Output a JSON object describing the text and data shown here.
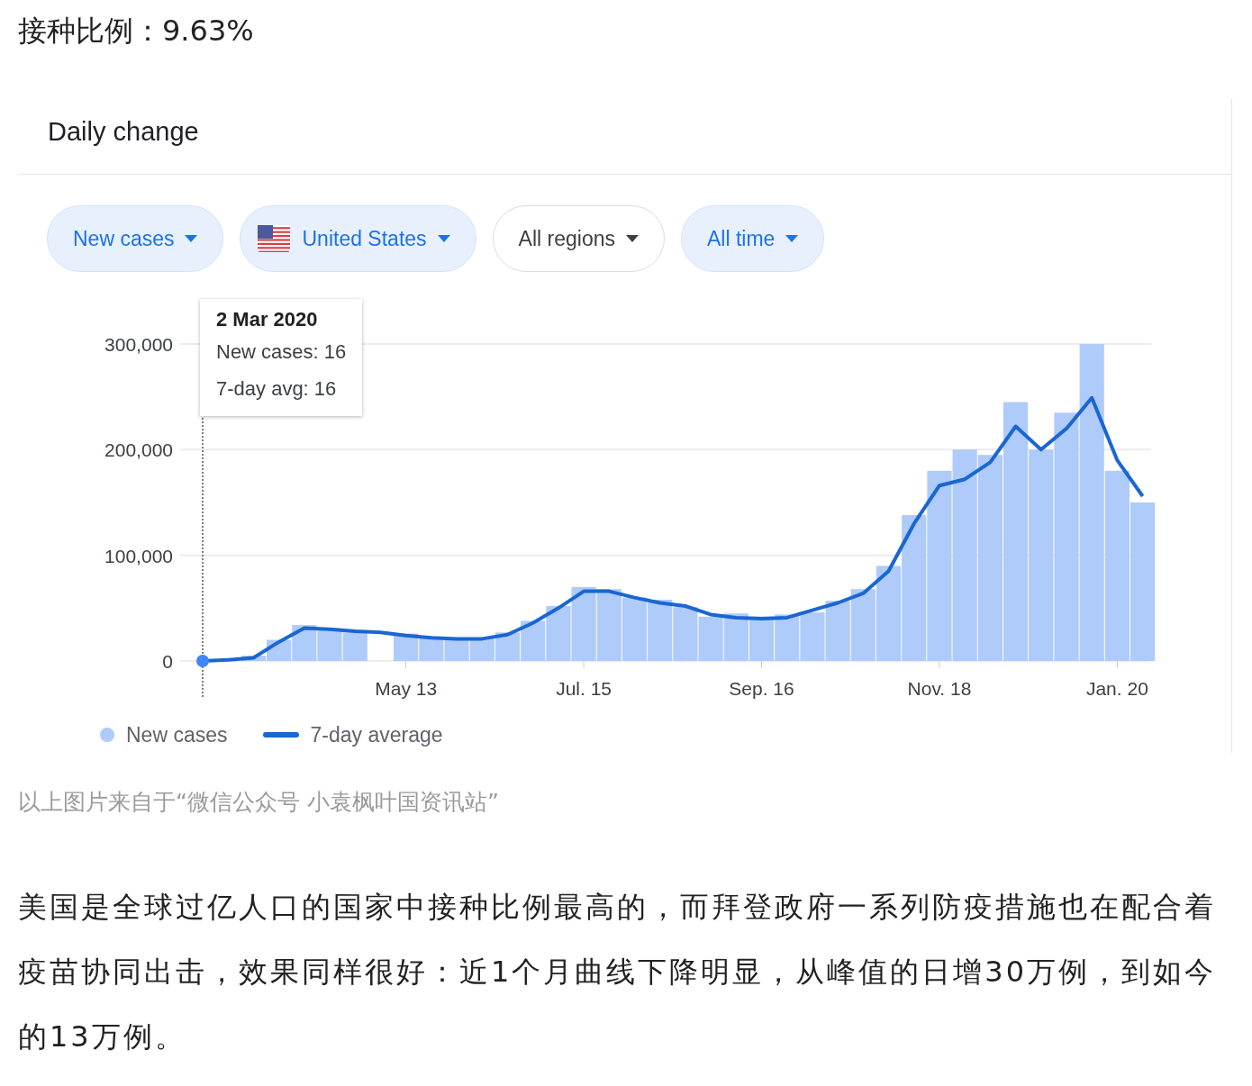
{
  "heading": "接种比例：9.63%",
  "card": {
    "title": "Daily change",
    "chips": [
      {
        "label": "New cases",
        "selected": true,
        "kind": "plain"
      },
      {
        "label": "United States",
        "selected": true,
        "kind": "flag"
      },
      {
        "label": "All regions",
        "selected": false,
        "kind": "plain"
      },
      {
        "label": "All time",
        "selected": true,
        "kind": "plain"
      }
    ],
    "tooltip": {
      "date": "2 Mar 2020",
      "lines": [
        "New cases: 16",
        "7-day avg: 16"
      ]
    },
    "chart_data": {
      "type": "bar",
      "ylim": [
        0,
        300000
      ],
      "categories": [
        null,
        null,
        null,
        null,
        null,
        null,
        null,
        null,
        "May 13",
        null,
        null,
        null,
        null,
        null,
        null,
        "Jul. 15",
        null,
        null,
        null,
        null,
        null,
        null,
        "Sep. 16",
        null,
        null,
        null,
        null,
        null,
        null,
        "Nov. 18",
        null,
        null,
        null,
        null,
        null,
        null,
        "Jan. 20",
        null
      ],
      "series": [
        {
          "name": "New cases",
          "color": "#aecbfa",
          "values": [
            0,
            null,
            5000,
            20000,
            34000,
            31000,
            27000,
            null,
            26000,
            23000,
            20000,
            22000,
            27000,
            38000,
            52000,
            70000,
            68000,
            60000,
            58000,
            51000,
            42000,
            45000,
            42000,
            44000,
            46000,
            57000,
            68000,
            90000,
            138000,
            180000,
            200000,
            195000,
            245000,
            200000,
            235000,
            300000,
            180000,
            150000
          ]
        },
        {
          "name": "7-day average",
          "type": "line",
          "color": "#1a66d2",
          "values": [
            0,
            1000,
            3000,
            18000,
            31000,
            30000,
            28000,
            27000,
            24000,
            22000,
            21000,
            21000,
            25000,
            36000,
            50000,
            66000,
            66000,
            60000,
            55000,
            52000,
            44000,
            41000,
            40000,
            41000,
            48000,
            55000,
            64000,
            85000,
            130000,
            166000,
            172000,
            188000,
            222000,
            200000,
            220000,
            249000,
            190000,
            156000
          ]
        }
      ],
      "yticks": [
        {
          "value": 0,
          "label": "0"
        },
        {
          "value": 100000,
          "label": "100,000"
        },
        {
          "value": 200000,
          "label": "200,000"
        },
        {
          "value": 300000,
          "label": "300,000"
        }
      ]
    }
  },
  "caption": "以上图片来自于“微信公众号 小袁枫叶国资讯站”",
  "paragraph": "美国是全球过亿人口的国家中接种比例最高的，而拜登政府一系列防疫措施也在配合着疫苗协同出击，效果同样很好：近1个月曲线下降明显，从峰值的日增30万例，到如今的13万例。"
}
